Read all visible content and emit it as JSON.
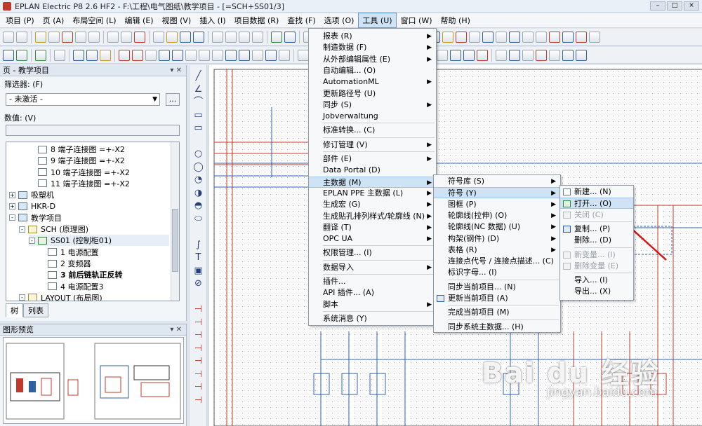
{
  "window": {
    "title": "EPLAN Electric P8 2.6 HF2 - F:\\工程\\电气图纸\\教学项目 - [=SCH+SS01/3]"
  },
  "menubar": [
    "项目 (P)",
    "页 (A)",
    "布局空间 (L)",
    "编辑 (E)",
    "视图 (V)",
    "插入 (I)",
    "项目数据 (R)",
    "查找 (F)",
    "选项 (O)",
    "工具 (U)",
    "窗口 (W)",
    "帮助 (H)"
  ],
  "active_menu_index": 9,
  "page_panel": {
    "title": "页 - 教学项目",
    "filter_label": "筛选器: (F)",
    "filter_value": "- 未激活 -",
    "filter_button": "...",
    "value_label": "数值: (V)",
    "tree": [
      {
        "label": "8 端子连接图 =+-X2",
        "type": "page",
        "level": 2
      },
      {
        "label": "9 端子连接图 =+-X2",
        "type": "page",
        "level": 2
      },
      {
        "label": "10 端子连接图 =+-X2",
        "type": "page",
        "level": 2
      },
      {
        "label": "11 端子连接图 =+-X2",
        "type": "page",
        "level": 2
      },
      {
        "label": "吸塑机",
        "type": "proj",
        "level": 0,
        "expand": "+"
      },
      {
        "label": "HKR-D",
        "type": "proj",
        "level": 0,
        "expand": "+"
      },
      {
        "label": "教学项目",
        "type": "proj",
        "level": 0,
        "expand": "-"
      },
      {
        "label": "SCH (原理图)",
        "type": "sch",
        "level": 1,
        "expand": "-"
      },
      {
        "label": "SS01 (控制柜01)",
        "type": "cab",
        "level": 2,
        "expand": "-",
        "selected": true
      },
      {
        "label": "1 电源配置",
        "type": "page",
        "level": 3
      },
      {
        "label": "2 变频器",
        "type": "page",
        "level": 3
      },
      {
        "label": "3 前后链轨正反转",
        "type": "page",
        "level": 3,
        "bold": true
      },
      {
        "label": "4 电源配置3",
        "type": "page",
        "level": 3
      },
      {
        "label": "LAYOUT (布局图)",
        "type": "sch",
        "level": 1,
        "expand": "-"
      }
    ],
    "tabs": [
      "树",
      "列表"
    ]
  },
  "preview_panel": {
    "title": "图形预览"
  },
  "tools_menu": [
    {
      "label": "报表 (R)",
      "sub": true
    },
    {
      "label": "制造数据 (F)",
      "sub": true
    },
    {
      "label": "从外部编辑属性 (E)",
      "sub": true
    },
    {
      "label": "自动编辑... (O)"
    },
    {
      "label": "AutomationML",
      "sub": true
    },
    {
      "label": "更新路径号 (U)"
    },
    {
      "label": "同步 (S)",
      "sub": true
    },
    {
      "label": "Jobverwaltung"
    },
    {
      "label": "标准转换... (C)",
      "sep_before": true
    },
    {
      "label": "修订管理 (V)",
      "sub": true,
      "sep_before": true
    },
    {
      "label": "部件 (E)",
      "sub": true,
      "sep_before": true
    },
    {
      "label": "Data Portal (D)"
    },
    {
      "label": "主数据 (M)",
      "sub": true,
      "highlight": true
    },
    {
      "label": "EPLAN PPE 主数据 (L)",
      "sub": true
    },
    {
      "label": "生成宏 (G)",
      "sub": true
    },
    {
      "label": "生成贴孔排列样式/轮廓线 (N)",
      "sub": true
    },
    {
      "label": "翻译 (T)",
      "sub": true
    },
    {
      "label": "OPC UA",
      "sub": true
    },
    {
      "label": "权限管理... (I)",
      "sep_before": true
    },
    {
      "label": "数据导入",
      "sub": true,
      "sep_before": true
    },
    {
      "label": "插件...",
      "sep_before": true
    },
    {
      "label": "API 插件... (A)"
    },
    {
      "label": "脚本",
      "sub": true
    },
    {
      "label": "系统消息 (Y)",
      "sep_before": true
    }
  ],
  "master_data_menu": [
    {
      "label": "符号库 (S)",
      "sub": true
    },
    {
      "label": "符号 (Y)",
      "sub": true,
      "highlight": true
    },
    {
      "label": "图框 (P)",
      "sub": true
    },
    {
      "label": "轮廓线(拉伸) (O)",
      "sub": true
    },
    {
      "label": "轮廓线(NC 数据) (U)",
      "sub": true
    },
    {
      "label": "构架(钢件) (D)",
      "sub": true
    },
    {
      "label": "表格 (R)",
      "sub": true
    },
    {
      "label": "连接点代号 / 连接点描述... (C)"
    },
    {
      "label": "标识字母... (I)"
    },
    {
      "label": "同步当前项目... (N)",
      "sep_before": true
    },
    {
      "label": "更新当前项目 (A)",
      "icon": "b"
    },
    {
      "label": "完成当前项目 (M)",
      "sep_before": true
    },
    {
      "label": "同步系统主数据... (H)",
      "sep_before": true
    }
  ],
  "symbol_menu": [
    {
      "label": "新建... (N)",
      "icon": "y"
    },
    {
      "label": "打开... (O)",
      "icon": "g",
      "highlight": true
    },
    {
      "label": "关闭 (C)",
      "icon": "d",
      "disabled": true
    },
    {
      "label": "复制... (P)",
      "icon": "b",
      "sep_before": true
    },
    {
      "label": "删除... (D)"
    },
    {
      "label": "新变量... (I)",
      "icon": "d",
      "disabled": true,
      "sep_before": true
    },
    {
      "label": "删除变量 (E)",
      "icon": "d",
      "disabled": true
    },
    {
      "label": "导入... (I)",
      "sep_before": true
    },
    {
      "label": "导出... (X)"
    }
  ],
  "watermark": {
    "brand": "Bai du 经验",
    "url": "jingyan.baidu.com"
  }
}
